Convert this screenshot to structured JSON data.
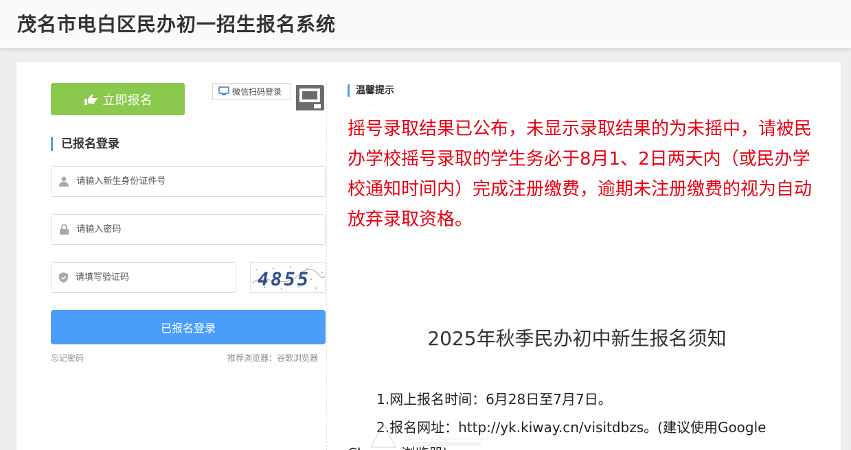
{
  "header": {
    "title": "茂名市电白区民办初一招生报名系统"
  },
  "login_panel": {
    "register_button": "立即报名",
    "wechat_login": "微信扫码登录",
    "section_title": "已报名登录",
    "id_placeholder": "请输入新生身份证件号",
    "password_placeholder": "请输入密码",
    "captcha_placeholder": "请填写验证码",
    "captcha_text": "4855",
    "login_button": "已报名登录",
    "forgot_password": "忘记密码",
    "browser_tip": "推荐浏览器：谷歌浏览器"
  },
  "notice": {
    "tips_title": "温馨提示",
    "alert_text": "摇号录取结果已公布，未显示录取结果的为未摇中，请被民办学校摇号录取的学生务必于8月1、2日两天内（或民办学校通知时间内）完成注册缴费，逾期未注册缴费的视为自动放弃录取资格。",
    "title": "2025年秋季民办初中新生报名须知",
    "item1": "1.网上报名时间：6月28日至7月7日。",
    "item2": "2.报名网址：http://yk.kiway.cn/visitdbzs。(建议使用Google",
    "item2_continued": "Chrome浏览器)"
  },
  "colors": {
    "register_green": "#8bc94e",
    "primary_blue": "#4a9df8",
    "alert_red": "#e60012"
  },
  "icons": [
    "hand-pointer-icon",
    "monitor-icon",
    "qr-code-icon",
    "user-icon",
    "lock-icon",
    "shield-icon"
  ]
}
